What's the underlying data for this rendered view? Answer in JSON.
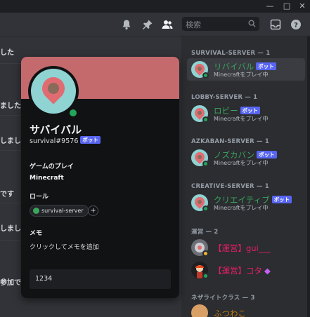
{
  "header": {
    "search_placeholder": "検索"
  },
  "chat": {
    "fragments": [
      "した",
      "ました",
      "しまし",
      "です",
      "しまし",
      "参加で"
    ]
  },
  "members": {
    "sections": [
      {
        "title": "SURVIVAL-SERVER — 1"
      },
      {
        "title": "LOBBY-SERVER — 1"
      },
      {
        "title": "AZKABAN-SERVER — 1"
      },
      {
        "title": "CREATIVE-SERVER — 1"
      },
      {
        "title": "運営 — 2"
      },
      {
        "title": "ネザライトクラス — 3"
      }
    ],
    "items": [
      {
        "name": "リバイバル",
        "badge": "ボット",
        "status": "Minecraftをプレイ中",
        "color": "#3ba55d"
      },
      {
        "name": "ロビー",
        "badge": "ボット",
        "status": "Minecraftをプレイ中",
        "color": "#3ba55d"
      },
      {
        "name": "ノズカバン",
        "badge": "ボット",
        "status": "Minecraftをプレイ中",
        "color": "#3ba55d"
      },
      {
        "name": "クリエイティブ",
        "badge": "ボット",
        "status": "Minecraftをプレイ中",
        "color": "#3ba55d"
      },
      {
        "name": "【運営】gui___",
        "color": "#e91e63"
      },
      {
        "name": "【運営】コタ",
        "color": "#e91e63"
      },
      {
        "name": "ふつわこ",
        "color": "#c27c0e"
      }
    ]
  },
  "profile": {
    "display_name": "サバイバル",
    "tag": "survival#9576",
    "badge": "ボット",
    "activity_heading": "ゲームのプレイ",
    "activity_value": "Minecraft",
    "roles_heading": "ロール",
    "role_name": "survival-server",
    "add_role": "+",
    "memo_heading": "メモ",
    "memo_placeholder": "クリックしてメモを追加",
    "input_value": "1234"
  },
  "colors": {
    "banner": "#c46a6d",
    "online": "#23a55a",
    "bot_badge": "#5865f2"
  }
}
